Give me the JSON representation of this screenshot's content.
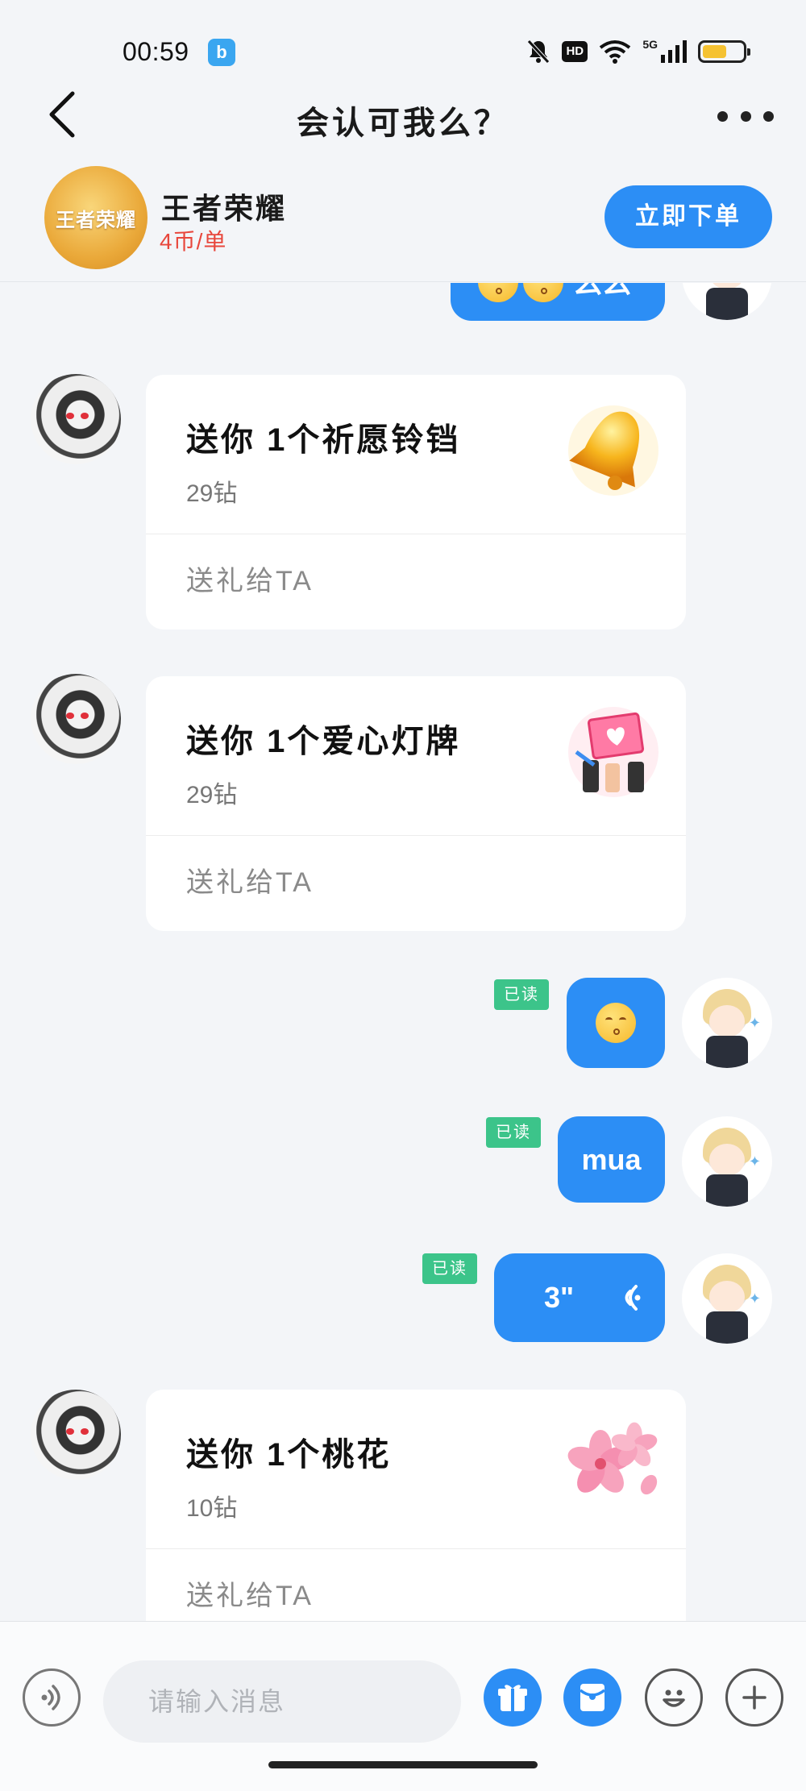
{
  "status_bar": {
    "time": "00:59",
    "network": "5G",
    "hd": "HD",
    "battery_level": 0.6,
    "app_icon": "b"
  },
  "nav": {
    "title": "会认可我么？",
    "back_icon": "chevron-left-icon",
    "more_icon": "more-dots-icon"
  },
  "game": {
    "name": "王者荣耀",
    "price": "4币/单",
    "logo_text": "王者荣耀",
    "order_label": "立即下单"
  },
  "colors": {
    "accent": "#2c8ef5",
    "read_tag": "#3cc48a",
    "price": "#e8473c",
    "background": "#f3f5f8"
  },
  "messages": {
    "partial_top": {
      "text": "么么"
    },
    "gift1": {
      "title": "送你 1个祈愿铃铛",
      "price": "29钻",
      "action": "送礼给TA",
      "icon": "bell-icon"
    },
    "gift2": {
      "title": "送你 1个爱心灯牌",
      "price": "29钻",
      "action": "送礼给TA",
      "icon": "heart-sign-icon"
    },
    "msg_emoji": {
      "read": "已读",
      "emoji": "kissing-face-emoji"
    },
    "msg_mua": {
      "read": "已读",
      "text": "mua"
    },
    "msg_voice": {
      "read": "已读",
      "duration": "3\""
    },
    "gift3": {
      "title": "送你 1个桃花",
      "price": "10钻",
      "action": "送礼给TA",
      "icon": "peach-blossom-icon"
    }
  },
  "input": {
    "placeholder": "请输入消息",
    "value": ""
  }
}
